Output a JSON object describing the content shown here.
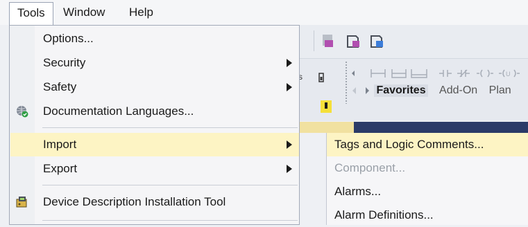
{
  "menubar": {
    "tools": "Tools",
    "window": "Window",
    "help": "Help"
  },
  "tools_menu": {
    "options": "Options...",
    "security": "Security",
    "safety": "Safety",
    "documentation_languages": "Documentation Languages...",
    "import": "Import",
    "export": "Export",
    "device_description_tool": "Device Description Installation Tool"
  },
  "import_submenu": {
    "tags_and_logic_comments": "Tags and Logic Comments...",
    "component": "Component...",
    "alarms": "Alarms...",
    "alarm_definitions": "Alarm Definitions..."
  },
  "instruction_toolbar": {
    "tabs": [
      "Favorites",
      "Add-On",
      "Plan"
    ]
  },
  "colors": {
    "highlight": "#fdf4c4",
    "menu_border": "#a2a9b8",
    "dark_bar": "#2b3a67"
  }
}
